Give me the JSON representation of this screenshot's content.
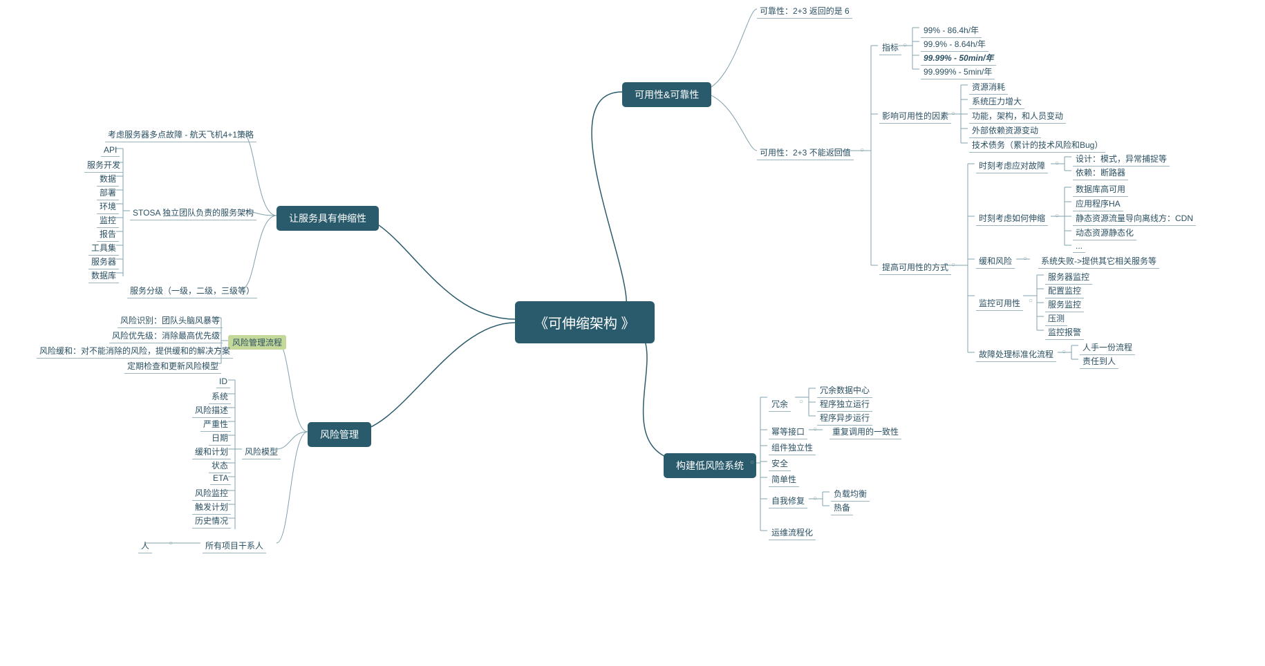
{
  "root": "《可伸缩架构 》",
  "left": {
    "scalable": {
      "title": "让服务具有伸缩性",
      "multiFault": "考虑服务器多点故障 - 航天飞机4+1策略",
      "stosa": {
        "label": "STOSA 独立团队负责的服务架构",
        "items": [
          "API",
          "服务开发",
          "数据",
          "部署",
          "环境",
          "监控",
          "报告",
          "工具集",
          "服务器",
          "数据库"
        ]
      },
      "tier": "服务分级（一级，二级，三级等）"
    },
    "risk": {
      "title": "风险管理",
      "process": {
        "label": "风险管理流程",
        "items": [
          "风险识别：团队头脑风暴等",
          "风险优先级：消除最高优先级",
          "风险缓和：对不能消除的风险，提供缓和的解决方案",
          "定期检查和更新风险模型"
        ]
      },
      "model": {
        "label": "风险模型",
        "items": [
          "ID",
          "系统",
          "风险描述",
          "严重性",
          "日期",
          "缓和计划",
          "状态",
          "ETA",
          "风险监控",
          "触发计划",
          "历史情况"
        ]
      },
      "stakeholders": {
        "label": "所有项目干系人",
        "child": "人"
      }
    }
  },
  "right": {
    "avail": {
      "title": "可用性&可靠性",
      "reliDef": "可靠性：2+3 返回的是 6",
      "availDef": {
        "label": "可用性：2+3 不能返回值",
        "indicator": {
          "label": "指标",
          "items": [
            "99% - 86.4h/年",
            "99.9% - 8.64h/年",
            "99.99% - 50min/年",
            "99.999% - 5min/年"
          ]
        },
        "factors": {
          "label": "影响可用性的因素",
          "items": [
            "资源消耗",
            "系统压力增大",
            "功能，架构，和人员变动",
            "外部依赖资源变动",
            "技术债务（累计的技术风险和Bug）"
          ]
        },
        "improve": {
          "label": "提高可用性的方式",
          "fault": {
            "label": "时刻考虑应对故障",
            "items": [
              "设计：模式，异常捕捉等",
              "依赖：断路器"
            ]
          },
          "scale": {
            "label": "时刻考虑如何伸缩",
            "items": [
              "数据库高可用",
              "应用程序HA",
              "静态资源流量导向离线方：CDN",
              "动态资源静态化",
              "..."
            ]
          },
          "mitigate": {
            "label": "缓和风险",
            "child": "系统失败->提供其它相关服务等"
          },
          "monitor": {
            "label": "监控可用性",
            "items": [
              "服务器监控",
              "配置监控",
              "服务监控",
              "压测",
              "监控报警"
            ]
          },
          "sop": {
            "label": "故障处理标准化流程",
            "items": [
              "人手一份流程",
              "责任到人"
            ]
          }
        }
      }
    },
    "lowrisk": {
      "title": "构建低风险系统",
      "redundancy": {
        "label": "冗余",
        "items": [
          "冗余数据中心",
          "程序独立运行",
          "程序异步运行"
        ]
      },
      "idempotent": {
        "label": "幂等接口",
        "child": "重复调用的一致性"
      },
      "independent": "组件独立性",
      "safety": "安全",
      "simple": "简单性",
      "selfheal": {
        "label": "自我修复",
        "items": [
          "负载均衡",
          "热备"
        ]
      },
      "ops": "运维流程化"
    }
  }
}
